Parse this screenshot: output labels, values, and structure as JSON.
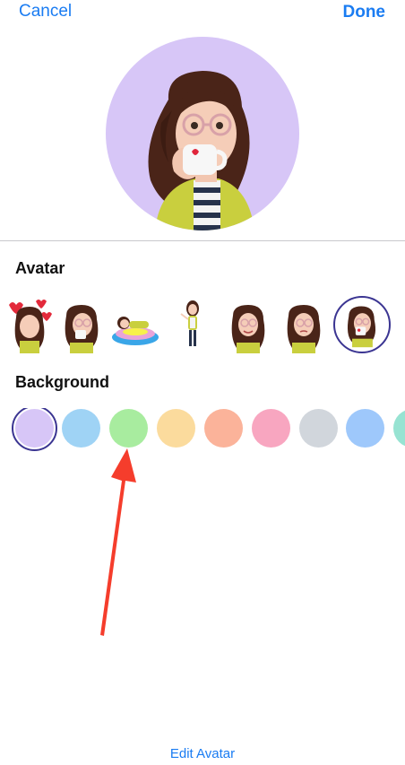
{
  "header": {
    "cancel_label": "Cancel",
    "done_label": "Done"
  },
  "hero": {
    "background": "#d7c6f7"
  },
  "sections": {
    "avatar_title": "Avatar",
    "background_title": "Background"
  },
  "avatar_options": [
    {
      "name": "hearts-pose"
    },
    {
      "name": "cup-pose-small"
    },
    {
      "name": "floating-pose"
    },
    {
      "name": "standing-pose"
    },
    {
      "name": "smile-pose"
    },
    {
      "name": "wink-pose"
    },
    {
      "name": "drinking-pose",
      "selected": true
    }
  ],
  "background_colors": [
    {
      "color": "#d7c6f7",
      "selected": true
    },
    {
      "color": "#9fd3f5"
    },
    {
      "color": "#a8ec9f"
    },
    {
      "color": "#fbdb9d"
    },
    {
      "color": "#fbb39a"
    },
    {
      "color": "#f8a6c0"
    },
    {
      "color": "#d1d6dc"
    },
    {
      "color": "#9ec8fb"
    },
    {
      "color": "#97e3d2"
    }
  ],
  "footer": {
    "edit_label": "Edit Avatar"
  },
  "annotation": {
    "type": "red-arrow",
    "color": "#f53d2c"
  }
}
